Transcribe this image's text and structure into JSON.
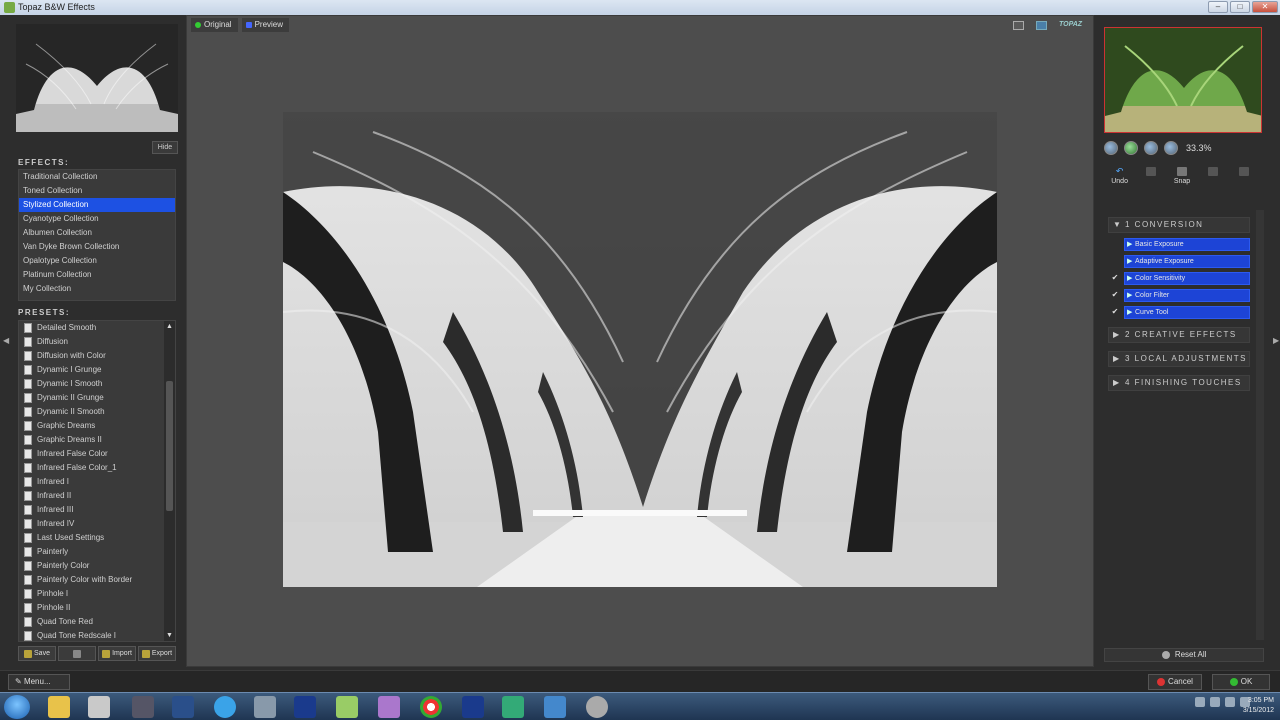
{
  "window": {
    "title": "Topaz B&W Effects"
  },
  "left": {
    "hide_label": "Hide",
    "effects_label": "EFFECTS:",
    "presets_label": "PRESETS:",
    "effects": [
      "Traditional Collection",
      "Toned Collection",
      "Stylized Collection",
      "Cyanotype Collection",
      "Albumen Collection",
      "Van Dyke Brown Collection",
      "Opalotype Collection",
      "Platinum Collection",
      "My Collection"
    ],
    "selected_effect": "Stylized Collection",
    "presets": [
      "Detailed Smooth",
      "Diffusion",
      "Diffusion with Color",
      "Dynamic I Grunge",
      "Dynamic I Smooth",
      "Dynamic II Grunge",
      "Dynamic II Smooth",
      "Graphic Dreams",
      "Graphic Dreams II",
      "Infrared False Color",
      "Infrared False Color_1",
      "Infrared I",
      "Infrared II",
      "Infrared III",
      "Infrared IV",
      "Last Used Settings",
      "Painterly",
      "Painterly Color",
      "Painterly Color with Border",
      "Pinhole I",
      "Pinhole II",
      "Quad Tone Red",
      "Quad Tone Redscale I"
    ],
    "buttons": {
      "save": "Save",
      "import": "Import",
      "export": "Export"
    }
  },
  "center": {
    "tab_original": "Original",
    "tab_preview": "Preview",
    "logo": "TOPAZ"
  },
  "right": {
    "zoom": "33.3%",
    "tools": {
      "undo": "Undo",
      "snap": "Snap"
    },
    "sections": [
      {
        "label": "1  CONVERSION",
        "open": true
      },
      {
        "label": "2  CREATIVE EFFECTS",
        "open": false
      },
      {
        "label": "3  LOCAL ADJUSTMENTS",
        "open": false
      },
      {
        "label": "4  FINISHING TOUCHES",
        "open": false
      }
    ],
    "conversion_items": [
      "Basic Exposure",
      "Adaptive Exposure",
      "Color Sensitivity",
      "Color Filter",
      "Curve Tool"
    ],
    "reset_label": "Reset All"
  },
  "footer": {
    "menu": "Menu...",
    "cancel": "Cancel",
    "ok": "OK"
  },
  "taskbar": {
    "time": "3:05 PM",
    "date": "3/15/2012"
  },
  "colors": {
    "selection": "#1d51e3",
    "panel": "#2d2d2d",
    "canvas": "#4d4d4d"
  }
}
